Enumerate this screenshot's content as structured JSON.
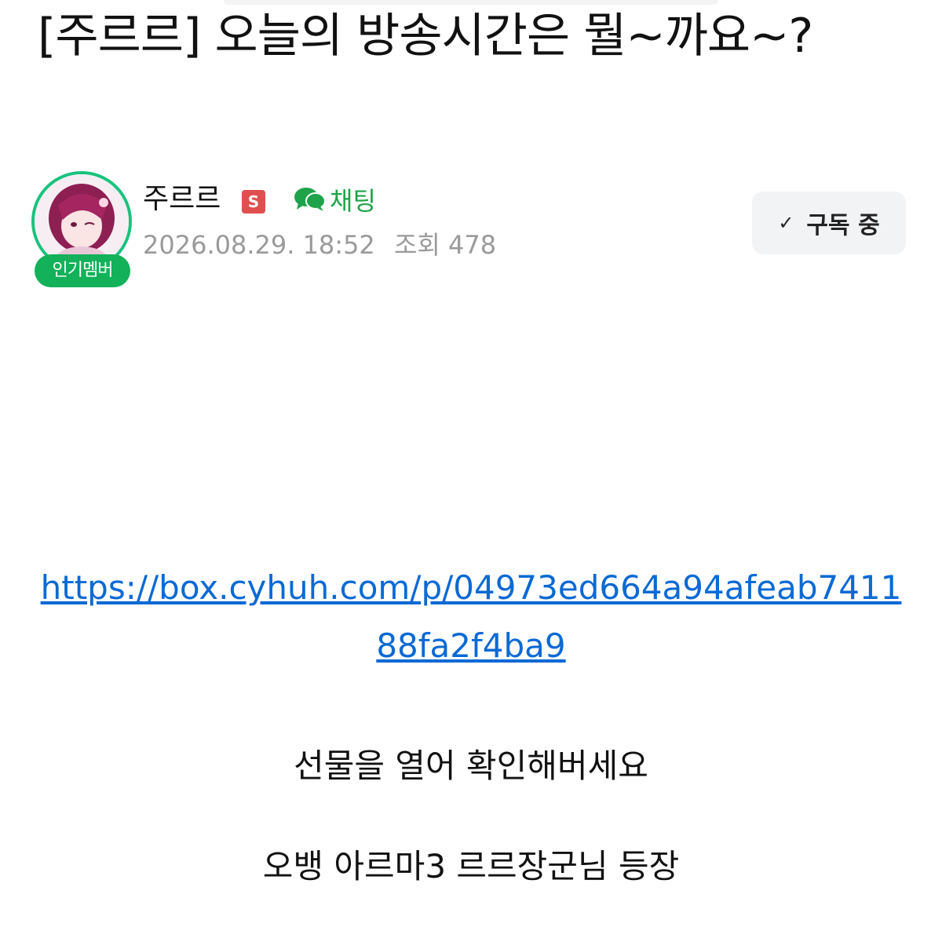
{
  "post": {
    "title": "[주르르] 오늘의 방송시간은 뭘~까요~?"
  },
  "author": {
    "name": "주르르",
    "tier_badge": "S",
    "member_badge": "인기멤버",
    "chat_label": "채팅",
    "date": "2026.08.29. 18:52",
    "views": "조회 478",
    "subscribe_label": "구독 중"
  },
  "icons": {
    "check": "check-icon",
    "chat": "chat-bubble-icon",
    "avatar": "avatar-image"
  },
  "colors": {
    "accent_green": "#19c37d",
    "badge_green": "#12b15a",
    "chat_green": "#1fa34a",
    "link_blue": "#0a69d4",
    "s_badge_red": "#e04f4f"
  },
  "body": {
    "link": "https://box.cyhuh.com/p/04973ed664a94afeab741188fa2f4ba9",
    "line1": "선물을 열어 확인해버세요",
    "line2": "오뱅 아르마3 르르장군님 등장"
  }
}
